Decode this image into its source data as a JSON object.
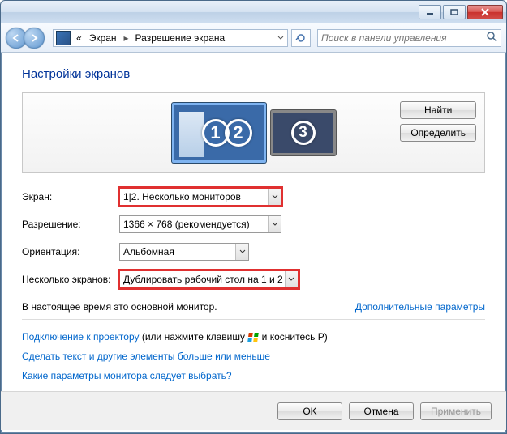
{
  "breadcrumb": {
    "root_prefix": "«",
    "seg1": "Экран",
    "seg2": "Разрешение экрана"
  },
  "search": {
    "placeholder": "Поиск в панели управления"
  },
  "heading": "Настройки экранов",
  "monitor_buttons": {
    "find": "Найти",
    "identify": "Определить"
  },
  "monitor_numbers": {
    "a": "1",
    "b": "2",
    "c": "3"
  },
  "fields": {
    "screen_label": "Экран:",
    "screen_value": "1|2. Несколько мониторов",
    "resolution_label": "Разрешение:",
    "resolution_value": "1366 × 768 (рекомендуется)",
    "orientation_label": "Ориентация:",
    "orientation_value": "Альбомная",
    "multi_label": "Несколько экранов:",
    "multi_value": "Дублировать рабочий стол на 1 и 2"
  },
  "info_primary": "В настоящее время это основной монитор.",
  "links": {
    "advanced": "Дополнительные параметры",
    "projector_link": "Подключение к проектору",
    "projector_suffix_a": " (или нажмите клавишу ",
    "projector_suffix_b": " и коснитесь P)",
    "text_size": "Сделать текст и другие элементы больше или меньше",
    "which_params": "Какие параметры монитора следует выбрать?"
  },
  "buttons": {
    "ok": "OK",
    "cancel": "Отмена",
    "apply": "Применить"
  }
}
